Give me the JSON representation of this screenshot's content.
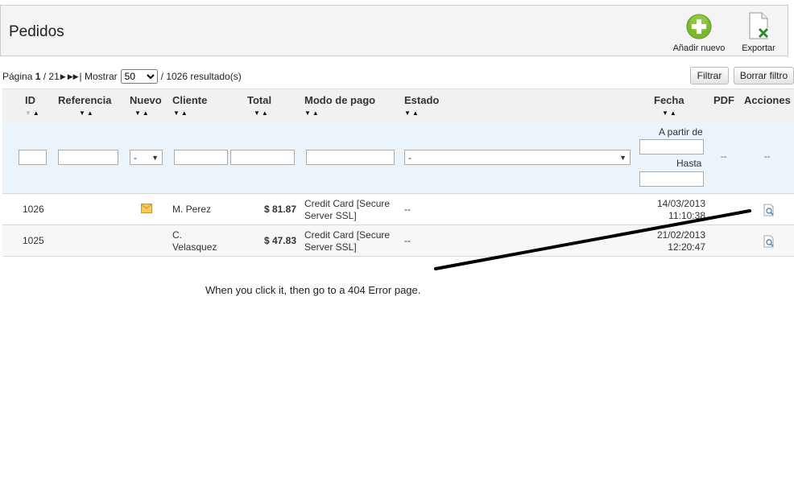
{
  "header": {
    "title": "Pedidos",
    "add_label": "Añadir nuevo",
    "export_label": "Exportar"
  },
  "pager": {
    "page_word": "Página",
    "current_page": "1",
    "total_pages": "/ 21",
    "show_word": "| Mostrar",
    "per_page": "50",
    "results": "/ 1026 resultado(s)"
  },
  "actions": {
    "filter_label": "Filtrar",
    "reset_label": "Borrar filtro"
  },
  "columns": {
    "id": "ID",
    "reference": "Referencia",
    "new": "Nuevo",
    "customer": "Cliente",
    "total": "Total",
    "payment": "Modo de pago",
    "status": "Estado",
    "date": "Fecha",
    "pdf": "PDF",
    "actions": "Acciones"
  },
  "filters": {
    "new_value": "-",
    "status_value": "-",
    "date_from_label": "A partir de",
    "date_to_label": "Hasta",
    "pdf_dash": "--",
    "actions_dash": "--"
  },
  "orders": [
    {
      "id": "1026",
      "customer_line1": "M. Perez",
      "customer_line2": "",
      "total": "$ 81.87",
      "payment_line1": "Credit Card [Secure",
      "payment_line2": "Server SSL]",
      "status": "--",
      "date": "14/03/2013",
      "time": "11:10:38",
      "has_new_icon": true
    },
    {
      "id": "1025",
      "customer_line1": "C.",
      "customer_line2": "Velasquez",
      "total": "$ 47.83",
      "payment_line1": "Credit Card [Secure",
      "payment_line2": "Server SSL]",
      "status": "--",
      "date": "21/02/2013",
      "time": "12:20:47",
      "has_new_icon": false
    }
  ],
  "annotation": "When you click it, then go to a 404 Error page.",
  "colors": {
    "add_icon_green": "#7cb82f",
    "filter_row_bg": "#ebf3fb",
    "header_bg": "#f1f1f1"
  }
}
